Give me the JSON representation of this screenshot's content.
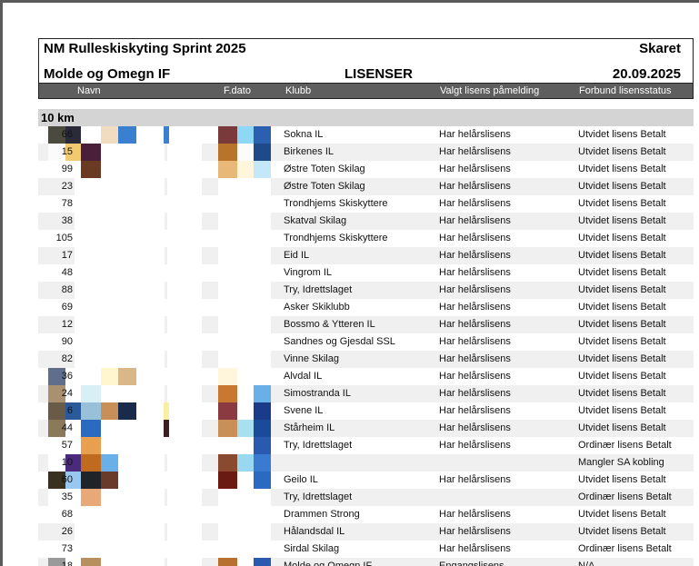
{
  "header": {
    "title": "NM Rulleskiskyting Sprint 2025",
    "venue": "Skaret",
    "organizer": "Molde og Omegn IF",
    "doc_type": "LISENSER",
    "date": "20.09.2025"
  },
  "columns": {
    "navn": "Navn",
    "fdato": "F.dato",
    "klubb": "Klubb",
    "valgt": "Valgt lisens påmelding",
    "forbund": "Forbund lisensstatus"
  },
  "section": {
    "title": "10 km"
  },
  "rows": [
    {
      "num": "66",
      "club": "Sokna IL",
      "lisens": "Har helårslisens",
      "status": "Utvidet lisens Betalt",
      "navn_colors": [
        "#4a4a3e",
        "#2a2a3a",
        "#ffffff",
        "#f2dcc0",
        "#3a7fd0"
      ],
      "navn_extra": "#3a7fd0",
      "fdato_colors": [
        "#7a3a3a",
        "#8fd8f5",
        "#2b5fb0"
      ]
    },
    {
      "num": "15",
      "club": "Birkenes IL",
      "lisens": "Har helårslisens",
      "status": "Utvidet lisens Betalt",
      "navn_colors": [
        "#fbfbfb",
        "#f2c870",
        "#4a1f3a",
        "#ffffff",
        "#ffffff"
      ],
      "navn_extra": "",
      "fdato_colors": [
        "#b8742a",
        "#fbfbfb",
        "#1e4a8a"
      ]
    },
    {
      "num": "99",
      "club": "Østre Toten Skilag",
      "lisens": "Har helårslisens",
      "status": "Utvidet lisens Betalt",
      "navn_colors": [
        "#ffffff",
        "#ffffff",
        "#6b3a22",
        "#ffffff",
        "#ffffff"
      ],
      "navn_extra": "",
      "fdato_colors": [
        "#e8b878",
        "#fff6dc",
        "#c4e8fa"
      ]
    },
    {
      "num": "23",
      "club": "Østre Toten Skilag",
      "lisens": "Har helårslisens",
      "status": "Utvidet lisens Betalt",
      "navn_colors": [],
      "navn_extra": "",
      "fdato_colors": []
    },
    {
      "num": "78",
      "club": "Trondhjems Skiskyttere",
      "lisens": "Har helårslisens",
      "status": "Utvidet lisens Betalt",
      "navn_colors": [],
      "navn_extra": "",
      "fdato_colors": []
    },
    {
      "num": "38",
      "club": "Skatval Skilag",
      "lisens": "Har helårslisens",
      "status": "Utvidet lisens Betalt",
      "navn_colors": [],
      "navn_extra": "",
      "fdato_colors": []
    },
    {
      "num": "105",
      "club": "Trondhjems Skiskyttere",
      "lisens": "Har helårslisens",
      "status": "Utvidet lisens Betalt",
      "navn_colors": [],
      "navn_extra": "",
      "fdato_colors": []
    },
    {
      "num": "17",
      "club": "Eid IL",
      "lisens": "Har helårslisens",
      "status": "Utvidet lisens Betalt",
      "navn_colors": [],
      "navn_extra": "",
      "fdato_colors": []
    },
    {
      "num": "48",
      "club": "Vingrom IL",
      "lisens": "Har helårslisens",
      "status": "Utvidet lisens Betalt",
      "navn_colors": [],
      "navn_extra": "",
      "fdato_colors": []
    },
    {
      "num": "88",
      "club": "Try, Idrettslaget",
      "lisens": "Har helårslisens",
      "status": "Utvidet lisens Betalt",
      "navn_colors": [],
      "navn_extra": "",
      "fdato_colors": []
    },
    {
      "num": "69",
      "club": "Asker Skiklubb",
      "lisens": "Har helårslisens",
      "status": "Utvidet lisens Betalt",
      "navn_colors": [],
      "navn_extra": "",
      "fdato_colors": []
    },
    {
      "num": "12",
      "club": "Bossmo & Ytteren IL",
      "lisens": "Har helårslisens",
      "status": "Utvidet lisens Betalt",
      "navn_colors": [],
      "navn_extra": "",
      "fdato_colors": []
    },
    {
      "num": "90",
      "club": "Sandnes og Gjesdal SSL",
      "lisens": "Har helårslisens",
      "status": "Utvidet lisens Betalt",
      "navn_colors": [],
      "navn_extra": "",
      "fdato_colors": []
    },
    {
      "num": "82",
      "club": "Vinne Skilag",
      "lisens": "Har helårslisens",
      "status": "Utvidet lisens Betalt",
      "navn_colors": [],
      "navn_extra": "",
      "fdato_colors": []
    },
    {
      "num": "36",
      "club": "Alvdal IL",
      "lisens": "Har helårslisens",
      "status": "Utvidet lisens Betalt",
      "navn_colors": [
        "#5f6e8a",
        "#ffffff",
        "#ffffff",
        "#fff6d0",
        "#d8b888"
      ],
      "navn_extra": "",
      "fdato_colors": [
        "#fff6dc",
        "#ffffff",
        "#ffffff"
      ]
    },
    {
      "num": "24",
      "club": "Simostranda IL",
      "lisens": "Har helårslisens",
      "status": "Utvidet lisens Betalt",
      "navn_colors": [
        "#a89070",
        "#ffffff",
        "#d8f0f5",
        "#ffffff",
        "#ffffff"
      ],
      "navn_extra": "",
      "fdato_colors": [
        "#c87830",
        "#ffffff",
        "#6ab0e8"
      ]
    },
    {
      "num": "6",
      "club": "Svene IL",
      "lisens": "Har helårslisens",
      "status": "Utvidet lisens Betalt",
      "navn_colors": [
        "#6a5a48",
        "#2a5a9a",
        "#98c0d8",
        "#c89058",
        "#1a2a4a"
      ],
      "navn_extra": "#f8f0a0",
      "fdato_colors": [
        "#8a3a40",
        "#ffffff",
        "#1a3a8a"
      ]
    },
    {
      "num": "44",
      "club": "Stårheim IL",
      "lisens": "Har helårslisens",
      "status": "Utvidet lisens Betalt",
      "navn_colors": [
        "#8a7a5a",
        "#ffffff",
        "#2a6ac0",
        "#ffffff",
        "#ffffff"
      ],
      "navn_extra": "#3a2020",
      "fdato_colors": [
        "#c89058",
        "#a8e0f0",
        "#1a4a9a"
      ]
    },
    {
      "num": "57",
      "club": "Try, Idrettslaget",
      "lisens": "Har helårslisens",
      "status": "Ordinær lisens Betalt",
      "navn_colors": [
        "#ffffff",
        "#ffffff",
        "#e8a050",
        "#ffffff",
        "#ffffff"
      ],
      "navn_extra": "",
      "fdato_colors": [
        "#ffffff",
        "#ffffff",
        "#2a5ab0"
      ]
    },
    {
      "num": "10",
      "club": "",
      "lisens": "",
      "status": "Mangler SA kobling",
      "navn_colors": [
        "#ffffff",
        "#4a2a7a",
        "#c06a20",
        "#6ab0e8",
        "#ffffff"
      ],
      "navn_extra": "",
      "fdato_colors": [
        "#8a4a30",
        "#98d8f0",
        "#3a7ad0"
      ]
    },
    {
      "num": "60",
      "club": "Geilo IL",
      "lisens": "Har helårslisens",
      "status": "Utvidet lisens Betalt",
      "navn_colors": [
        "#3a3020",
        "#98c8f0",
        "#202428",
        "#6a3a2a",
        "#ffffff"
      ],
      "navn_extra": "",
      "fdato_colors": [
        "#6a1a10",
        "#ffffff",
        "#2a6ac0"
      ]
    },
    {
      "num": "35",
      "club": "Try, Idrettslaget",
      "lisens": "",
      "status": "Ordinær lisens Betalt",
      "navn_colors": [
        "#ffffff",
        "#ffffff",
        "#e8a878",
        "#ffffff",
        "#ffffff"
      ],
      "navn_extra": "",
      "fdato_colors": []
    },
    {
      "num": "68",
      "club": "Drammen Strong",
      "lisens": "Har helårslisens",
      "status": "Utvidet lisens Betalt",
      "navn_colors": [],
      "navn_extra": "",
      "fdato_colors": []
    },
    {
      "num": "26",
      "club": "Hålandsdal IL",
      "lisens": "Har helårslisens",
      "status": "Utvidet lisens Betalt",
      "navn_colors": [],
      "navn_extra": "",
      "fdato_colors": []
    },
    {
      "num": "73",
      "club": "Sirdal Skilag",
      "lisens": "Har helårslisens",
      "status": "Ordinær lisens Betalt",
      "navn_colors": [],
      "navn_extra": "",
      "fdato_colors": []
    },
    {
      "num": "18",
      "club": "Molde og Omegn IF",
      "lisens": "Engangslisens",
      "status": "N/A",
      "navn_colors": [
        "#9a9a9a",
        "#ffffff",
        "#b89060",
        "#ffffff",
        "#ffffff"
      ],
      "navn_extra": "",
      "fdato_colors": [
        "#b87030",
        "#ffffff",
        "#2a5ab0"
      ]
    }
  ]
}
